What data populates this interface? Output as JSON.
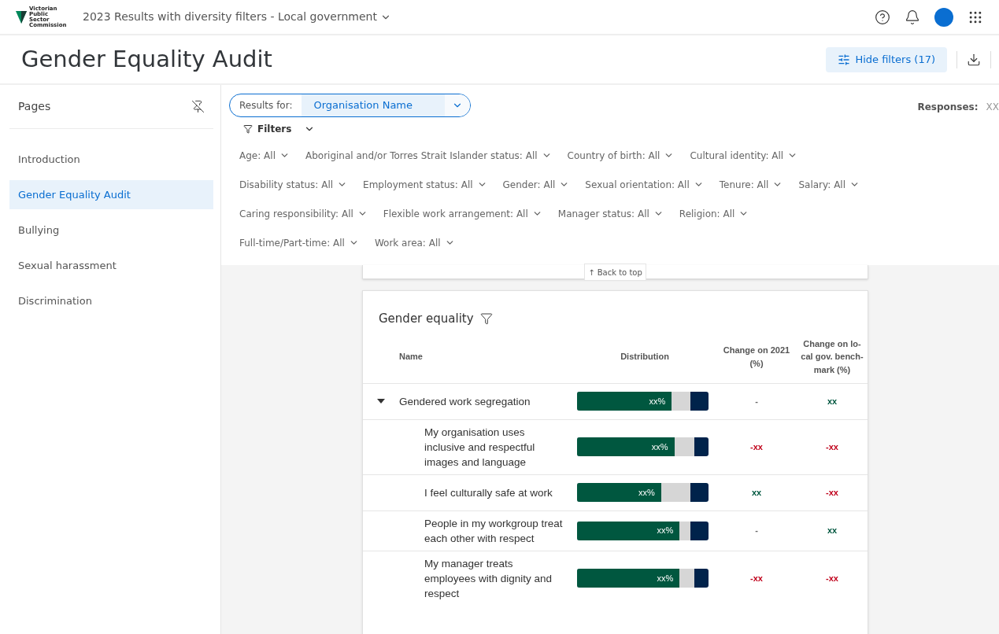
{
  "header": {
    "logo_text": "Victorian Public Sector Commission",
    "report_title": "2023 Results with diversity filters - Local government"
  },
  "page": {
    "title": "Gender Equality Audit",
    "hide_filters": "Hide filters (17)"
  },
  "sidebar": {
    "title": "Pages",
    "items": [
      {
        "label": "Introduction",
        "selected": false
      },
      {
        "label": "Gender Equality Audit",
        "selected": true
      },
      {
        "label": "Bullying",
        "selected": false
      },
      {
        "label": "Sexual harassment",
        "selected": false
      },
      {
        "label": "Discrimination",
        "selected": false
      }
    ]
  },
  "results_for": {
    "label": "Results for:",
    "value": "Organisation Name"
  },
  "responses": {
    "label": "Responses:",
    "value": "XX"
  },
  "filters_label": "Filters",
  "filter_rows": [
    [
      {
        "label": "Age:",
        "value": "All"
      },
      {
        "label": "Aboriginal and/or Torres Strait Islander status:",
        "value": "All"
      },
      {
        "label": "Country of birth:",
        "value": "All"
      },
      {
        "label": "Cultural identity:",
        "value": "All"
      }
    ],
    [
      {
        "label": "Disability status:",
        "value": "All"
      },
      {
        "label": "Employment status:",
        "value": "All"
      },
      {
        "label": "Gender:",
        "value": "All"
      },
      {
        "label": "Sexual orientation:",
        "value": "All"
      },
      {
        "label": "Tenure:",
        "value": "All"
      },
      {
        "label": "Salary:",
        "value": "All"
      }
    ],
    [
      {
        "label": "Caring responsibility:",
        "value": "All"
      },
      {
        "label": "Flexible work arrangement:",
        "value": "All"
      },
      {
        "label": "Manager status:",
        "value": "All"
      },
      {
        "label": "Religion:",
        "value": "All"
      }
    ],
    [
      {
        "label": "Full-time/Part-time:",
        "value": "All"
      },
      {
        "label": "Work area:",
        "value": "All"
      }
    ]
  ],
  "back_to_top": "↑ Back to top",
  "card": {
    "title": "Gender equality",
    "columns": [
      "Name",
      "Distribution",
      "Change on 2021 (%)",
      "Change on lo-cal gov. bench-mark (%)"
    ],
    "rows": [
      {
        "name": "Gendered work segregation",
        "expanded": true,
        "bar_label": "xx%",
        "fills": [
          {
            "level": 0.72,
            "color": "#00573f"
          },
          {
            "level": 0.86,
            "color": "#d6d6d6"
          }
        ],
        "change_2021": {
          "text": "-"
        },
        "change_benchmark": {
          "text": "xx",
          "color": "#00573f"
        },
        "children": [
          {
            "name": "My organisation uses inclusive and respectful images and language",
            "bar_label": "xx%",
            "fills": [
              {
                "level": 0.74,
                "color": "#00573f"
              },
              {
                "level": 0.89,
                "color": "#d6d6d6"
              }
            ],
            "change_2021": {
              "text": "-xx",
              "color": "#c0001a"
            },
            "change_benchmark": {
              "text": "-xx",
              "color": "#c0001a"
            }
          },
          {
            "name": "I feel culturally safe at work",
            "bar_label": "xx%",
            "fills": [
              {
                "level": 0.64,
                "color": "#00573f"
              },
              {
                "level": 0.86,
                "color": "#d6d6d6"
              }
            ],
            "change_2021": {
              "text": "xx",
              "color": "#00573f"
            },
            "change_benchmark": {
              "text": "-xx",
              "color": "#c0001a"
            }
          },
          {
            "name": "People in my workgroup treat each other with respect",
            "bar_label": "xx%",
            "fills": [
              {
                "level": 0.78,
                "color": "#00573f"
              },
              {
                "level": 0.86,
                "color": "#d6d6d6"
              }
            ],
            "change_2021": {
              "text": "-"
            },
            "change_benchmark": {
              "text": "xx",
              "color": "#00573f"
            }
          },
          {
            "name": "My manager treats employees with dignity and respect",
            "bar_label": "xx%",
            "fills": [
              {
                "level": 0.78,
                "color": "#00573f"
              },
              {
                "level": 0.89,
                "color": "#d6d6d6"
              }
            ],
            "change_2021": {
              "text": "-xx",
              "color": "#c0001a"
            },
            "change_benchmark": {
              "text": "-xx",
              "color": "#c0001a"
            }
          }
        ]
      }
    ]
  }
}
